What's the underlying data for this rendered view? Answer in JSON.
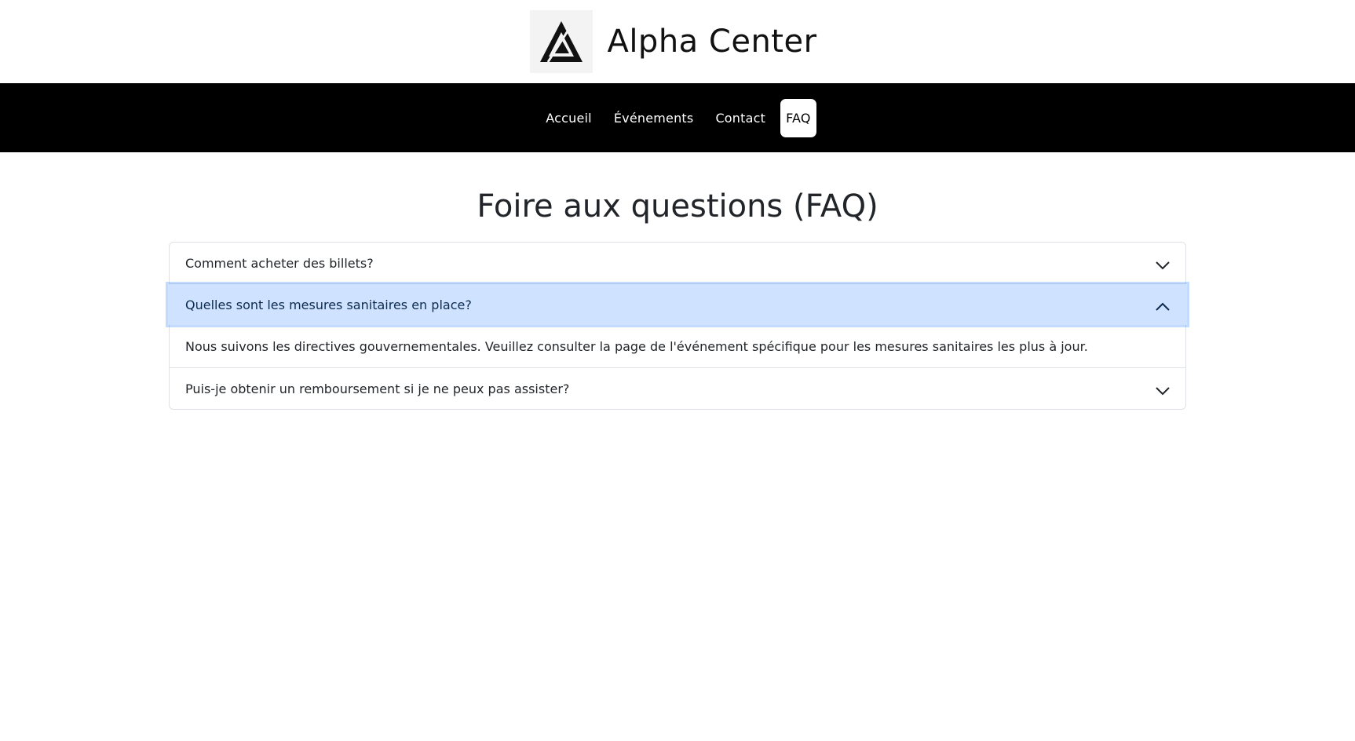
{
  "brand": {
    "name": "Alpha Center",
    "logo_icon": "triangle-logo-icon"
  },
  "nav": {
    "items": [
      {
        "label": "Accueil",
        "active": false
      },
      {
        "label": "Événements",
        "active": false
      },
      {
        "label": "Contact",
        "active": false
      },
      {
        "label": "FAQ",
        "active": true
      }
    ]
  },
  "page": {
    "title": "Foire aux questions (FAQ)"
  },
  "faq": {
    "items": [
      {
        "question": "Comment acheter des billets?",
        "expanded": false,
        "icon": "chevron-down-icon"
      },
      {
        "question": "Quelles sont les mesures sanitaires en place?",
        "expanded": true,
        "icon": "chevron-up-icon",
        "answer": "Nous suivons les directives gouvernementales. Veuillez consulter la page de l'événement spécifique pour les mesures sanitaires les plus à jour."
      },
      {
        "question": "Puis-je obtenir un remboursement si je ne peux pas assister?",
        "expanded": false,
        "icon": "chevron-down-icon"
      }
    ]
  },
  "colors": {
    "navbar_bg": "#000000",
    "active_question_bg": "#cfe2ff",
    "border": "#dee2e6"
  }
}
